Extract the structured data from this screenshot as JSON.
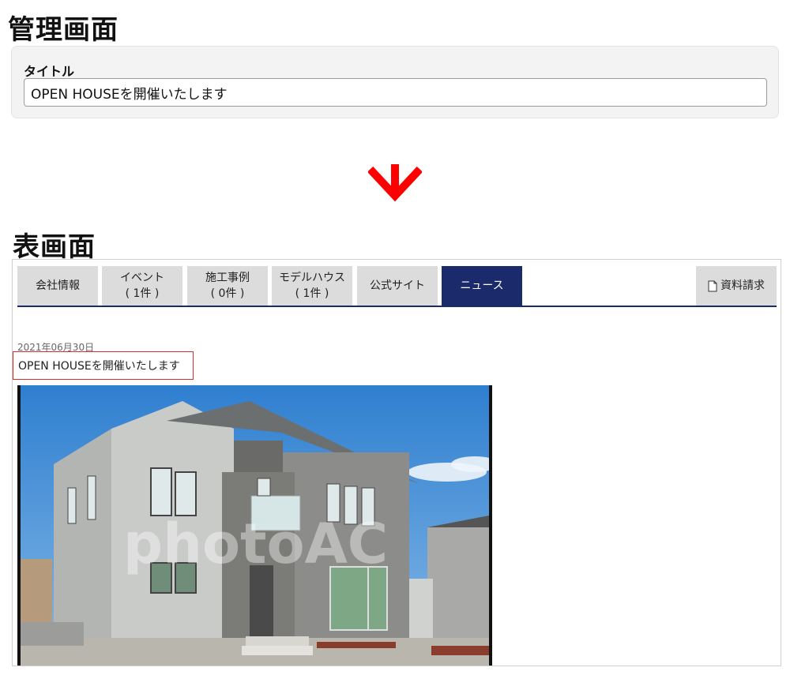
{
  "admin": {
    "heading": "管理画面",
    "field_label": "タイトル",
    "title_value": "OPEN HOUSEを開催いたします"
  },
  "front": {
    "heading": "表画面",
    "tabs": [
      {
        "line1": "会社情報",
        "line2": ""
      },
      {
        "line1": "イベント",
        "line2": "( 1件 )"
      },
      {
        "line1": "施工事例",
        "line2": "( 0件 )"
      },
      {
        "line1": "モデルハウス",
        "line2": "( 1件 )"
      },
      {
        "line1": "公式サイト",
        "line2": ""
      },
      {
        "line1": "ニュース",
        "line2": ""
      }
    ],
    "request_tab": "資料請求",
    "news": {
      "date": "2021年06月30日",
      "title": "OPEN HOUSEを開催いたします",
      "photo_watermark": "photoAC"
    }
  },
  "colors": {
    "arrow": "#ff0000",
    "active_tab": "#1b2a6b",
    "highlight_border": "#d62c2c"
  },
  "icons": {
    "arrow": "arrow-down-icon",
    "request": "document-icon"
  }
}
